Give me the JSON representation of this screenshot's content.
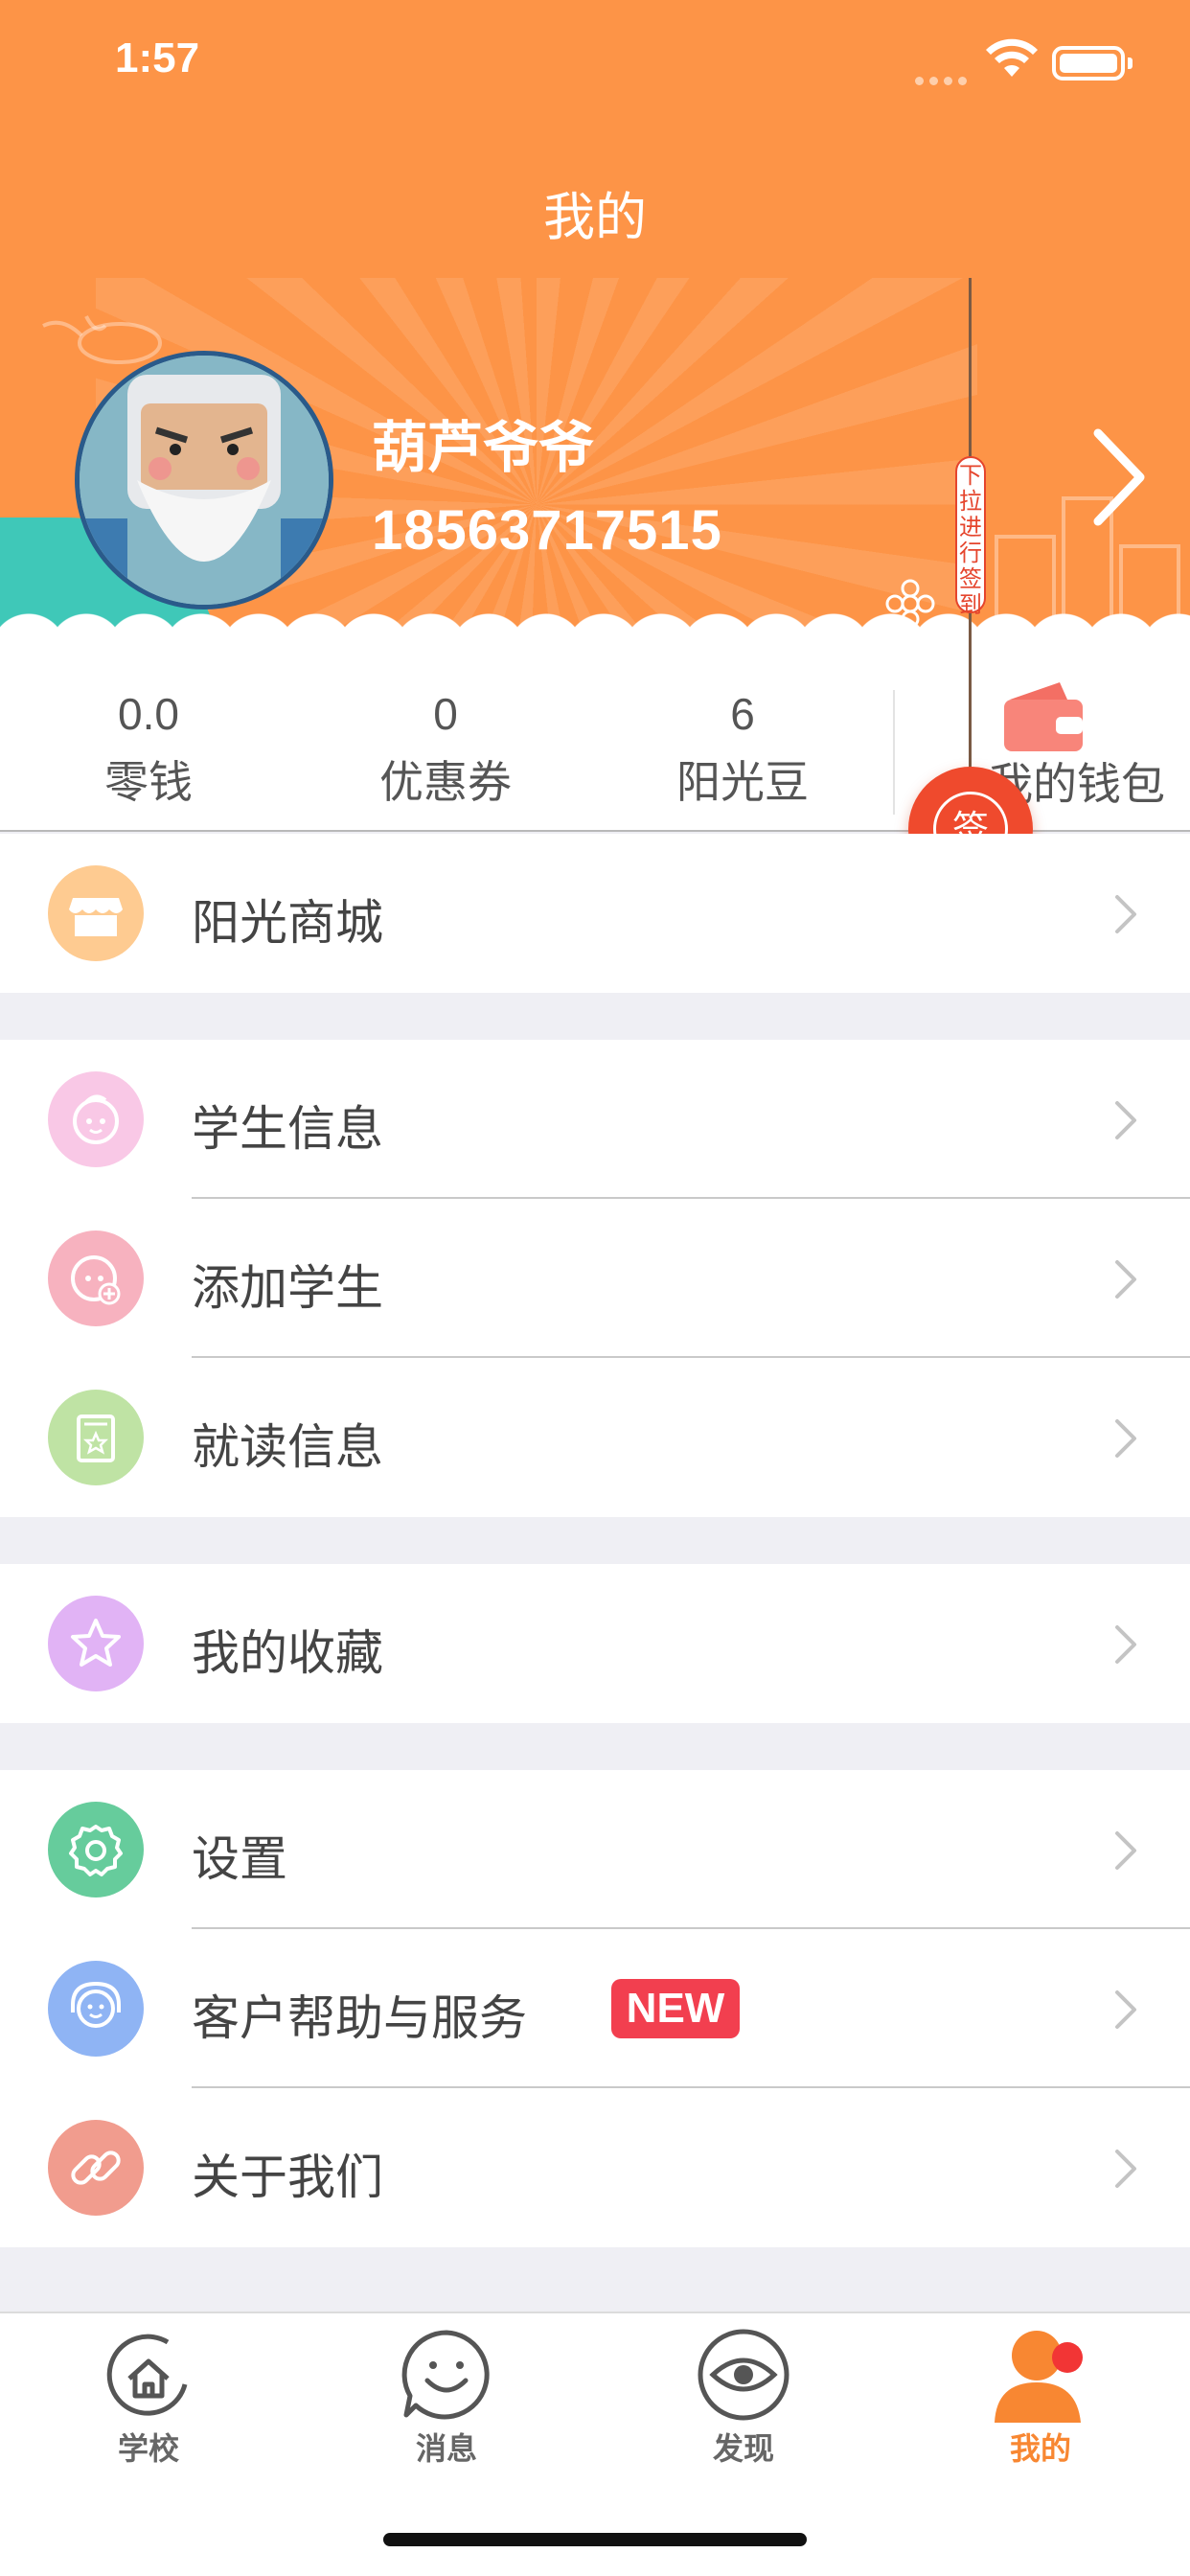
{
  "status_bar": {
    "time": "1:57"
  },
  "header": {
    "title": "我的"
  },
  "profile": {
    "name": "葫芦爷爷",
    "phone": "18563717515"
  },
  "signin": {
    "pull_hint": "下拉进行签到",
    "button_label": "签"
  },
  "stats": [
    {
      "value": "0.0",
      "label": "零钱"
    },
    {
      "value": "0",
      "label": "优惠券"
    },
    {
      "value": "6",
      "label": "阳光豆"
    }
  ],
  "wallet": {
    "label": "我的钱包"
  },
  "menu": {
    "shop": {
      "label": "阳光商城",
      "icon": "store-icon",
      "color": "#fecb91"
    },
    "student_info": {
      "label": "学生信息",
      "icon": "child-face-icon",
      "color": "#f9c8e6"
    },
    "add_student": {
      "label": "添加学生",
      "icon": "add-child-icon",
      "color": "#f7b2bf"
    },
    "enrollment": {
      "label": "就读信息",
      "icon": "certificate-icon",
      "color": "#bfe3a4"
    },
    "favorites": {
      "label": "我的收藏",
      "icon": "star-icon",
      "color": "#e1b3f5"
    },
    "settings": {
      "label": "设置",
      "icon": "gear-icon",
      "color": "#66cc9c"
    },
    "support": {
      "label": "客户帮助与服务",
      "badge": "NEW",
      "icon": "headset-icon",
      "color": "#8fb4f4"
    },
    "about": {
      "label": "关于我们",
      "icon": "link-icon",
      "color": "#f19c8e"
    }
  },
  "tabbar": {
    "school": "学校",
    "messages": "消息",
    "discover": "发现",
    "mine": "我的",
    "active": "mine",
    "active_color": "#f88732"
  },
  "colors": {
    "header": "#fd9447",
    "accent": "#ef4a2d",
    "badge": "#f23f4f"
  }
}
